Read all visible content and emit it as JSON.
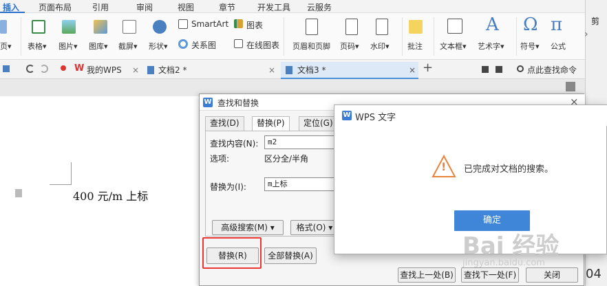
{
  "ribbon": {
    "tabs": [
      "插入",
      "页面布局",
      "引用",
      "审阅",
      "视图",
      "章节",
      "开发工具",
      "云服务"
    ],
    "items": {
      "page": "页▾",
      "table": "表格▾",
      "picture": "图片▾",
      "gallery": "图库▾",
      "screenshot": "截屏▾",
      "shape": "形状▾",
      "smartart": "SmartArt",
      "chart": "图表",
      "relation": "关系图",
      "online_chart": "在线图表",
      "header_footer": "页眉和页脚",
      "page_number": "页码▾",
      "watermark": "水印▾",
      "comment": "批注",
      "textbox": "文本框▾",
      "wordart": "艺术字▾",
      "symbol": "符号▾",
      "formula": "公式"
    },
    "icon_glyphs": {
      "wordart": "A",
      "symbol": "Ω",
      "formula": "π"
    }
  },
  "docbar": {
    "tabs": [
      "我的WPS",
      "文档2 *",
      "文档3 *"
    ],
    "close_glyph": "×",
    "plus_glyph": "+",
    "search_command": "点此查找命令"
  },
  "document": {
    "text": "400 元/m 上标"
  },
  "find_replace": {
    "title": "查找和替换",
    "tabs": [
      "查找(D)",
      "替换(P)",
      "定位(G)"
    ],
    "find_label": "查找内容(N):",
    "find_value": "m2",
    "options_label": "选项:",
    "options_value": "区分全/半角",
    "replace_label": "替换为(I):",
    "replace_value": "m上标",
    "advanced_search": "高级搜索(M) ▾",
    "format": "格式(O) ▾",
    "replace_btn": "替换(R)",
    "replace_all_btn": "全部替换(A)",
    "find_prev": "查找上一处(B)",
    "find_next": "查找下一处(F)",
    "close_btn": "关闭",
    "close_glyph": "×"
  },
  "message": {
    "title": "WPS 文字",
    "text": "已完成对文档的搜索。",
    "ok": "确定",
    "warning_glyph": "!"
  },
  "side": {
    "labels": [
      "剪",
      "04"
    ]
  },
  "watermark": {
    "line1": "Bai 经验",
    "line2": "jingyan.baidu.com"
  },
  "logo_letter": "W",
  "colors": {
    "accent": "#3b7cd6",
    "ok_button": "#3f86d8",
    "highlight": "#e33333",
    "warning": "#e8833a"
  }
}
